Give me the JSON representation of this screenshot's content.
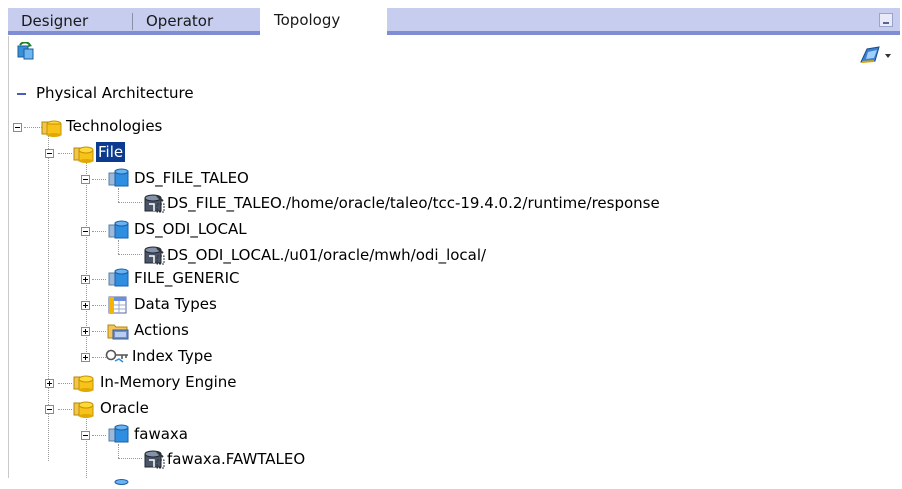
{
  "tabs": [
    {
      "label": "Designer"
    },
    {
      "label": "Operator"
    },
    {
      "label": "Topology"
    }
  ],
  "section": {
    "label": "Physical Architecture"
  },
  "tree": {
    "technologies": "Technologies",
    "file": "File",
    "ds_file_taleo": "DS_FILE_TALEO",
    "ds_file_taleo_schema": "DS_FILE_TALEO./home/oracle/taleo/tcc-19.4.0.2/runtime/response",
    "ds_odi_local": "DS_ODI_LOCAL",
    "ds_odi_local_schema": "DS_ODI_LOCAL./u01/oracle/mwh/odi_local/",
    "file_generic": "FILE_GENERIC",
    "data_types": "Data Types",
    "actions": "Actions",
    "index_type": "Index Type",
    "in_memory_engine": "In-Memory Engine",
    "oracle": "Oracle",
    "fawaxa": "fawaxa",
    "fawaxa_schema": "fawaxa.FAWTALEO"
  },
  "colors": {
    "tab_stripe": "#c6cdee",
    "selection": "#0b3a8f",
    "folder_yellow": "#f6c21c",
    "server_blue": "#2f8ee0"
  }
}
